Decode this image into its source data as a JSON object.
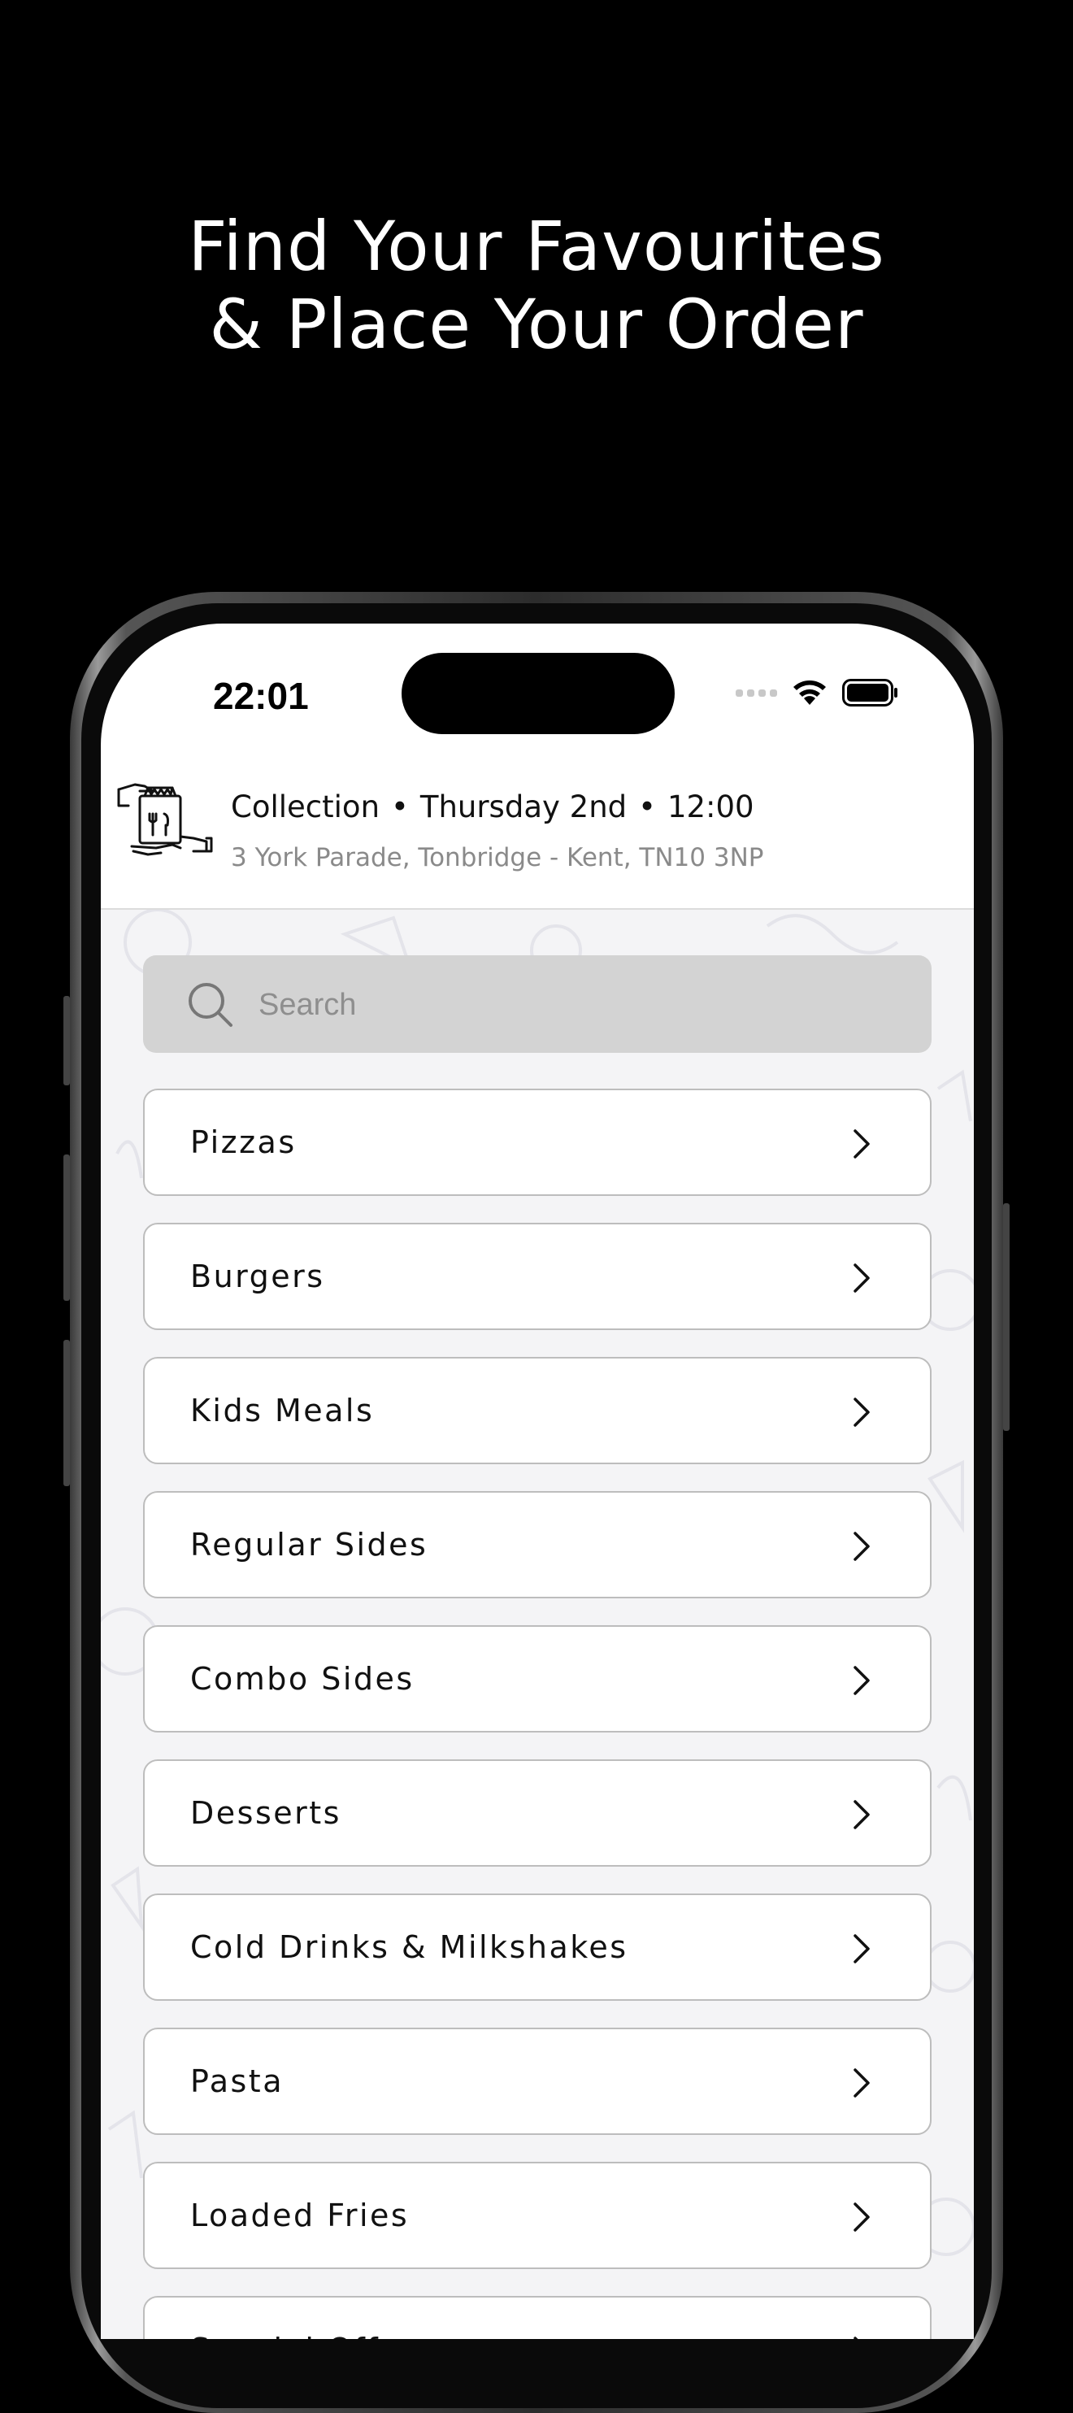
{
  "promo": {
    "headline_line1": "Find Your Favourites",
    "headline_line2": "& Place Your Order"
  },
  "status_bar": {
    "time": "22:01"
  },
  "order_info": {
    "mode": "Collection",
    "day": "Thursday 2nd",
    "time": "12:00",
    "address": "3 York Parade, Tonbridge - Kent, TN10  3NP"
  },
  "search": {
    "placeholder": "Search"
  },
  "categories": [
    {
      "label": "Pizzas"
    },
    {
      "label": "Burgers"
    },
    {
      "label": "Kids Meals"
    },
    {
      "label": "Regular Sides"
    },
    {
      "label": "Combo Sides"
    },
    {
      "label": "Desserts"
    },
    {
      "label": "Cold Drinks & Milkshakes"
    },
    {
      "label": "Pasta"
    },
    {
      "label": "Loaded Fries"
    },
    {
      "label": "Special Offers"
    }
  ],
  "colors": {
    "background": "#000000",
    "screen_bg": "#f4f4f6",
    "search_bg": "#d3d3d3",
    "card_border": "#bdbdbd"
  }
}
